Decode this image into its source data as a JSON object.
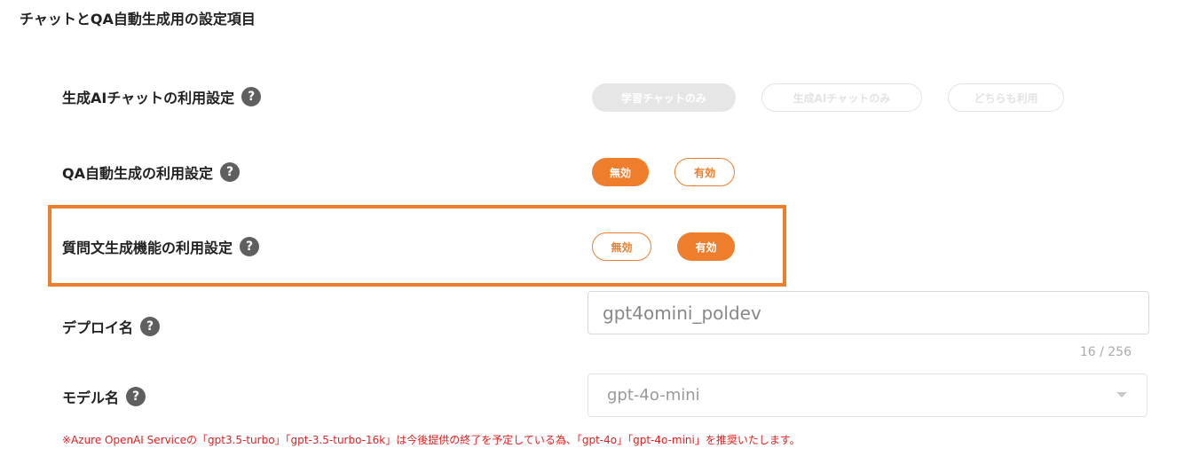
{
  "section_title": "チャットとQA自動生成用の設定項目",
  "help_glyph": "?",
  "rows": {
    "chat_usage": {
      "label": "生成AIチャットの利用設定",
      "options": [
        "学習チャットのみ",
        "生成AIチャットのみ",
        "どちらも利用"
      ]
    },
    "qa_auto": {
      "label": "QA自動生成の利用設定",
      "options": [
        "無効",
        "有効"
      ],
      "selected": "無効"
    },
    "question_gen": {
      "label": "質問文生成機能の利用設定",
      "options": [
        "無効",
        "有効"
      ],
      "selected": "有効"
    },
    "deploy_name": {
      "label": "デプロイ名",
      "value": "gpt4omini_poldev",
      "counter": "16 / 256"
    },
    "model_name": {
      "label": "モデル名",
      "value": "gpt-4o-mini"
    }
  },
  "note": "※Azure OpenAI Serviceの「gpt3.5-turbo」「gpt-3.5-turbo-16k」は今後提供の終了を予定している為、「gpt-4o」「gpt-4o-mini」を推奨いたします。",
  "colors": {
    "accent": "#ee7d2c",
    "disabled": "#e6e6e6",
    "warning": "#e02020"
  },
  "icons": {
    "help": "question-circle-icon",
    "dropdown": "chevron-down-icon"
  }
}
